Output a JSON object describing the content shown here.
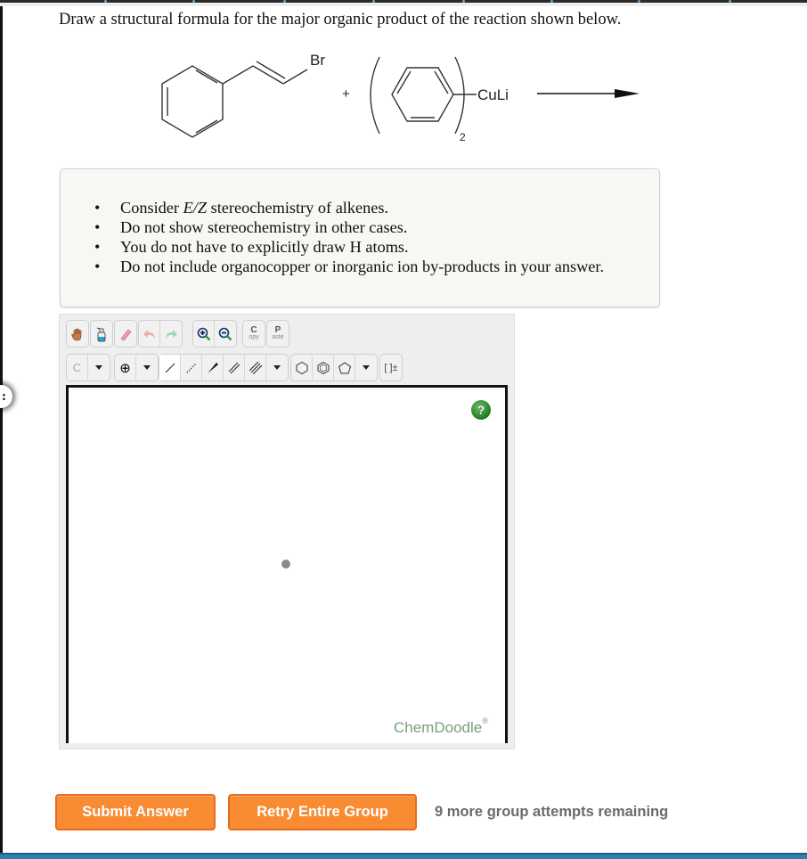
{
  "question": {
    "prompt": "Draw a structural formula for the major organic product of the reaction shown below."
  },
  "reaction": {
    "reactant1_substituent": "Br",
    "plus": "+",
    "reagent_label": "CuLi",
    "reagent_subscript": "2",
    "arrow": "reaction-arrow"
  },
  "hints": {
    "items": [
      {
        "pre": "Consider ",
        "em": "E/Z",
        "post": " stereochemistry of alkenes."
      },
      {
        "pre": "Do not show stereochemistry in other cases.",
        "em": "",
        "post": ""
      },
      {
        "pre": "You do not have to explicitly draw H atoms.",
        "em": "",
        "post": ""
      },
      {
        "pre": "Do not include organocopper or inorganic ion by-products in your answer.",
        "em": "",
        "post": ""
      }
    ]
  },
  "editor": {
    "toolbar_row1": [
      {
        "name": "hand-tool",
        "icon": "hand-icon"
      },
      {
        "name": "clear-tool",
        "icon": "spray-bottle-icon"
      },
      {
        "name": "eraser-tool",
        "icon": "eraser-icon"
      },
      {
        "name": "undo",
        "icon": "undo-icon"
      },
      {
        "name": "redo",
        "icon": "redo-icon"
      },
      {
        "name": "zoom-in",
        "icon": "zoom-in-icon"
      },
      {
        "name": "zoom-out",
        "icon": "zoom-out-icon"
      },
      {
        "name": "copy",
        "label_top": "C",
        "label_bottom": "opy"
      },
      {
        "name": "paste",
        "label_top": "P",
        "label_bottom": "aste"
      }
    ],
    "atom_selector": "C",
    "charge_symbol": "⊕",
    "bond_tools": [
      "single-bond",
      "hashed-bond",
      "wedge-bond",
      "double-bond",
      "triple-bond"
    ],
    "ring_tools": [
      "cyclohexane",
      "benzene",
      "cyclopentane"
    ],
    "bracket_label": "[ ]±",
    "help_label": "?",
    "brand": "ChemDoodle",
    "brand_mark": "®"
  },
  "actions": {
    "submit_label": "Submit Answer",
    "retry_label": "Retry Entire Group",
    "attempts_text": "9 more group attempts remaining"
  },
  "colors": {
    "button_orange": "#f98c33",
    "button_border": "#e86a1e",
    "brand_green": "#7a9e78",
    "help_green": "#1e7a1e"
  }
}
